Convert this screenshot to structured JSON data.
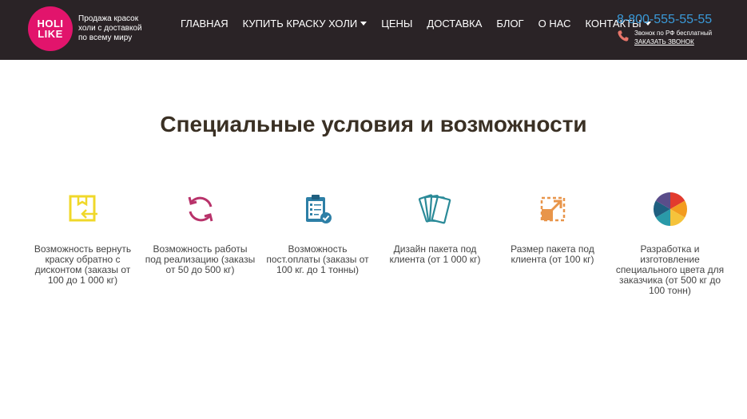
{
  "header": {
    "logo": {
      "line1": "HOLI",
      "line2": "LIKE"
    },
    "tagline": "Продажа красок холи с доставкой по всему миру",
    "nav": [
      {
        "label": "ГЛАВНАЯ",
        "has_dropdown": false
      },
      {
        "label": "КУПИТЬ КРАСКУ ХОЛИ",
        "has_dropdown": true
      },
      {
        "label": "ЦЕНЫ",
        "has_dropdown": false
      },
      {
        "label": "ДОСТАВКА",
        "has_dropdown": false
      },
      {
        "label": "БЛОГ",
        "has_dropdown": false
      },
      {
        "label": "О НАС",
        "has_dropdown": false
      },
      {
        "label": "КОНТАКТЫ",
        "has_dropdown": true
      }
    ],
    "contact": {
      "phone": "8-800-555-55-55",
      "note": "Звонок по РФ бесплатный",
      "callback_label": "ЗАКАЗАТЬ ЗВОНОК"
    }
  },
  "main": {
    "title": "Специальные условия и возможности",
    "features": [
      {
        "icon": "box-return-icon",
        "text": "Возможность вернуть краску обратно с дисконтом (заказы от 100 до 1 000 кг)"
      },
      {
        "icon": "refresh-cycle-icon",
        "text": "Возможность работы под реализацию (заказы от 50 до 500 кг)"
      },
      {
        "icon": "clipboard-check-icon",
        "text": "Возможность пост.оплаты (заказы от 100 кг. до 1 тонны)"
      },
      {
        "icon": "package-cards-icon",
        "text": "Дизайн пакета под клиента (от 1 000 кг)"
      },
      {
        "icon": "resize-arrow-icon",
        "text": "Размер пакета под клиента (от 100 кг)"
      },
      {
        "icon": "color-wheel-icon",
        "text": "Разработка и изготовление специального цвета для заказчика (от 500 кг до 100 тонн)"
      }
    ]
  },
  "colors": {
    "header_bg": "#2a2326",
    "logo_pink": "#e2146c",
    "phone_blue": "#3a9ad9",
    "title": "#3a3024"
  }
}
